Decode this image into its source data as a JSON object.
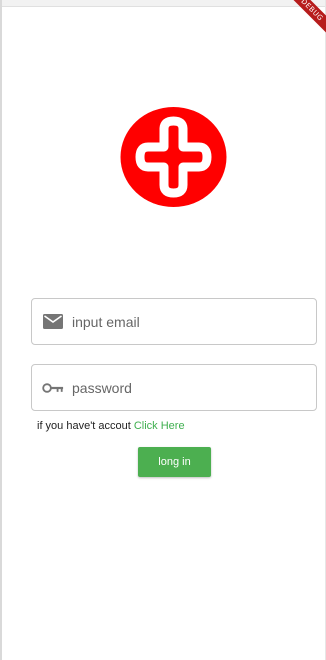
{
  "debug_banner": "DEBUG",
  "logo": {
    "icon": "red-cross-logo-icon",
    "color": "#ff0000"
  },
  "email_field": {
    "placeholder": "input email",
    "value": "",
    "icon": "mail-icon"
  },
  "password_field": {
    "placeholder": "password",
    "value": "",
    "icon": "key-icon"
  },
  "signup": {
    "prompt": "if you have't accout",
    "link_label": "Click Here",
    "link_color": "#3faf4f"
  },
  "login_button": {
    "label": "long in",
    "color": "#4caf50"
  }
}
